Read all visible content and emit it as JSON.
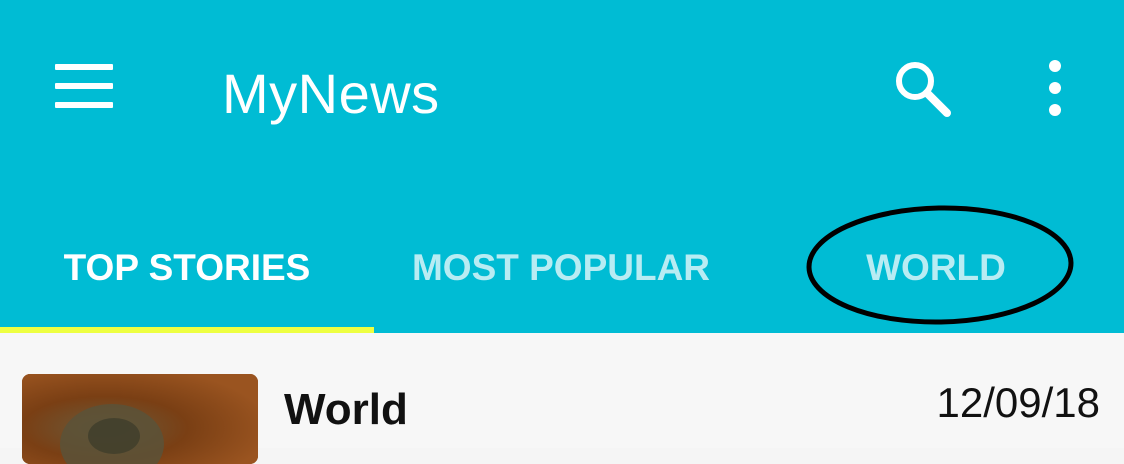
{
  "app": {
    "title": "MyNews"
  },
  "tabs": [
    {
      "label": "TOP STORIES",
      "selected": true
    },
    {
      "label": "MOST POPULAR",
      "selected": false
    },
    {
      "label": "WORLD",
      "selected": false
    }
  ],
  "list": {
    "items": [
      {
        "section": "World",
        "date": "12/09/18"
      }
    ]
  },
  "icons": {
    "menu": "hamburger-menu-icon",
    "search": "search-icon",
    "more": "more-vertical-icon"
  },
  "colors": {
    "primary": "#00bcd4",
    "indicator": "#eeff41",
    "annotation": "#000000"
  }
}
